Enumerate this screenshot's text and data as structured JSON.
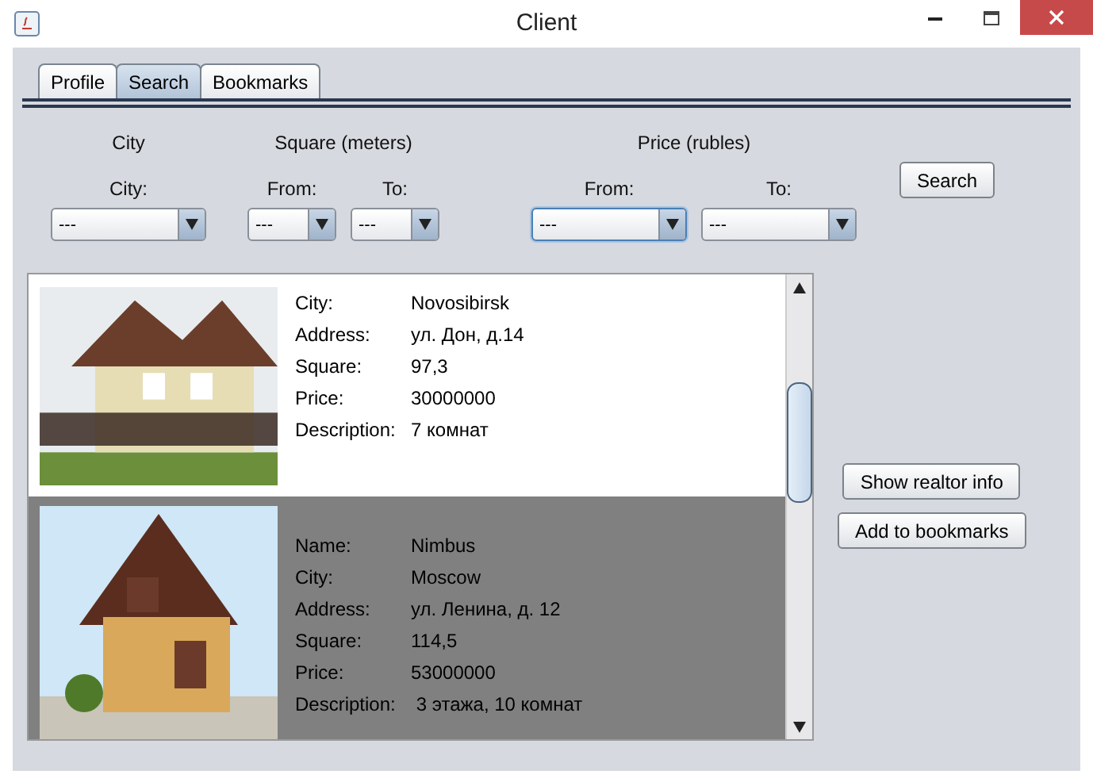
{
  "window": {
    "title": "Client"
  },
  "tabs": [
    {
      "label": "Profile",
      "selected": false
    },
    {
      "label": "Search",
      "selected": true
    },
    {
      "label": "Bookmarks",
      "selected": false
    }
  ],
  "filters": [
    {
      "heading": "City",
      "fields": [
        {
          "label": "City:",
          "value": "---",
          "focused": false
        }
      ]
    },
    {
      "heading": "Square (meters)",
      "fields": [
        {
          "label": "From:",
          "value": "---",
          "focused": false
        },
        {
          "label": "To:",
          "value": "---",
          "focused": false
        }
      ]
    },
    {
      "heading": "Price (rubles)",
      "fields": [
        {
          "label": "From:",
          "value": "---",
          "focused": true
        },
        {
          "label": "To:",
          "value": "---",
          "focused": false
        }
      ]
    }
  ],
  "search_button": "Search",
  "listings": [
    {
      "selected": false,
      "fields": [
        {
          "label": "City:",
          "value": "Novosibirsk"
        },
        {
          "label": "Address:",
          "value": "ул. Дон, д.14"
        },
        {
          "label": "Square:",
          "value": "97,3"
        },
        {
          "label": "Price:",
          "value": "30000000"
        },
        {
          "label": "Description:",
          "value": "7 комнат"
        }
      ]
    },
    {
      "selected": true,
      "fields": [
        {
          "label": "Name:",
          "value": "Nimbus"
        },
        {
          "label": "City:",
          "value": "Moscow"
        },
        {
          "label": "Address:",
          "value": "ул. Ленина, д. 12"
        },
        {
          "label": "Square:",
          "value": "114,5"
        },
        {
          "label": "Price:",
          "value": "53000000"
        },
        {
          "label": "Description:",
          "value": " 3 этажа, 10 комнат"
        }
      ]
    }
  ],
  "actions": [
    "Show realtor info",
    "Add to bookmarks"
  ]
}
